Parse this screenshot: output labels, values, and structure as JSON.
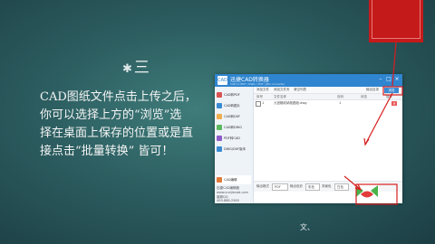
{
  "slide": {
    "title_star": "✱",
    "title_text": "三",
    "paragraph_lines": [
      "CAD图纸文件点击上传之后，",
      "你可以选择上方的“浏览”选",
      "择在桌面上保存的位置或是直",
      "接点击“批量转换” 皆可！"
    ],
    "bottom_mark": "文",
    "bottom_mark_suffix": "、"
  },
  "app": {
    "logo": "CAD",
    "title": "迅捷CAD转换器",
    "subtitle": "CAD to PDF / DWG / DXF / JPG converter",
    "window_buttons": [
      "–",
      "□",
      "×"
    ],
    "sidebar_items": [
      {
        "label": "CAD转PDF",
        "color": "#d9534f"
      },
      {
        "label": "CAD转图片",
        "color": "#3a8ad2"
      },
      {
        "label": "CAD转DXF",
        "color": "#f0ad4e"
      },
      {
        "label": "CAD转DWG",
        "color": "#5cb85c"
      },
      {
        "label": "PDF转CAD",
        "color": "#8e5cc8"
      },
      {
        "label": "DWG/DXF版本",
        "color": "#3a8ad2"
      },
      {
        "label": "CAD编辑",
        "color": "#e07b39"
      }
    ],
    "sidebar_bottom": [
      "迅捷CAD编辑器",
      "www.xunjiecad.com",
      "客服QQ",
      "400-888-2560"
    ],
    "toolbar": {
      "add_file": "添加文件",
      "add_folder": "添加文件夹",
      "clear": "清空列表",
      "output_label": "输出目录"
    },
    "browse_label": "浏览",
    "table_headers": [
      "序号",
      "文件名称",
      "页码",
      "状态",
      "操作"
    ],
    "rows": [
      {
        "index": "1",
        "name": "九宫格收纳柜图纸.dwg",
        "pages": "1",
        "status": "",
        "action": "✕"
      }
    ],
    "bottom_bar": {
      "output_format_label": "输出格式",
      "output_format_value": "PDF",
      "color_label": "输出色彩",
      "color_value": "彩色",
      "bg_label": "背景色",
      "bg_value": "白色"
    },
    "convert_label": "批量转换"
  }
}
